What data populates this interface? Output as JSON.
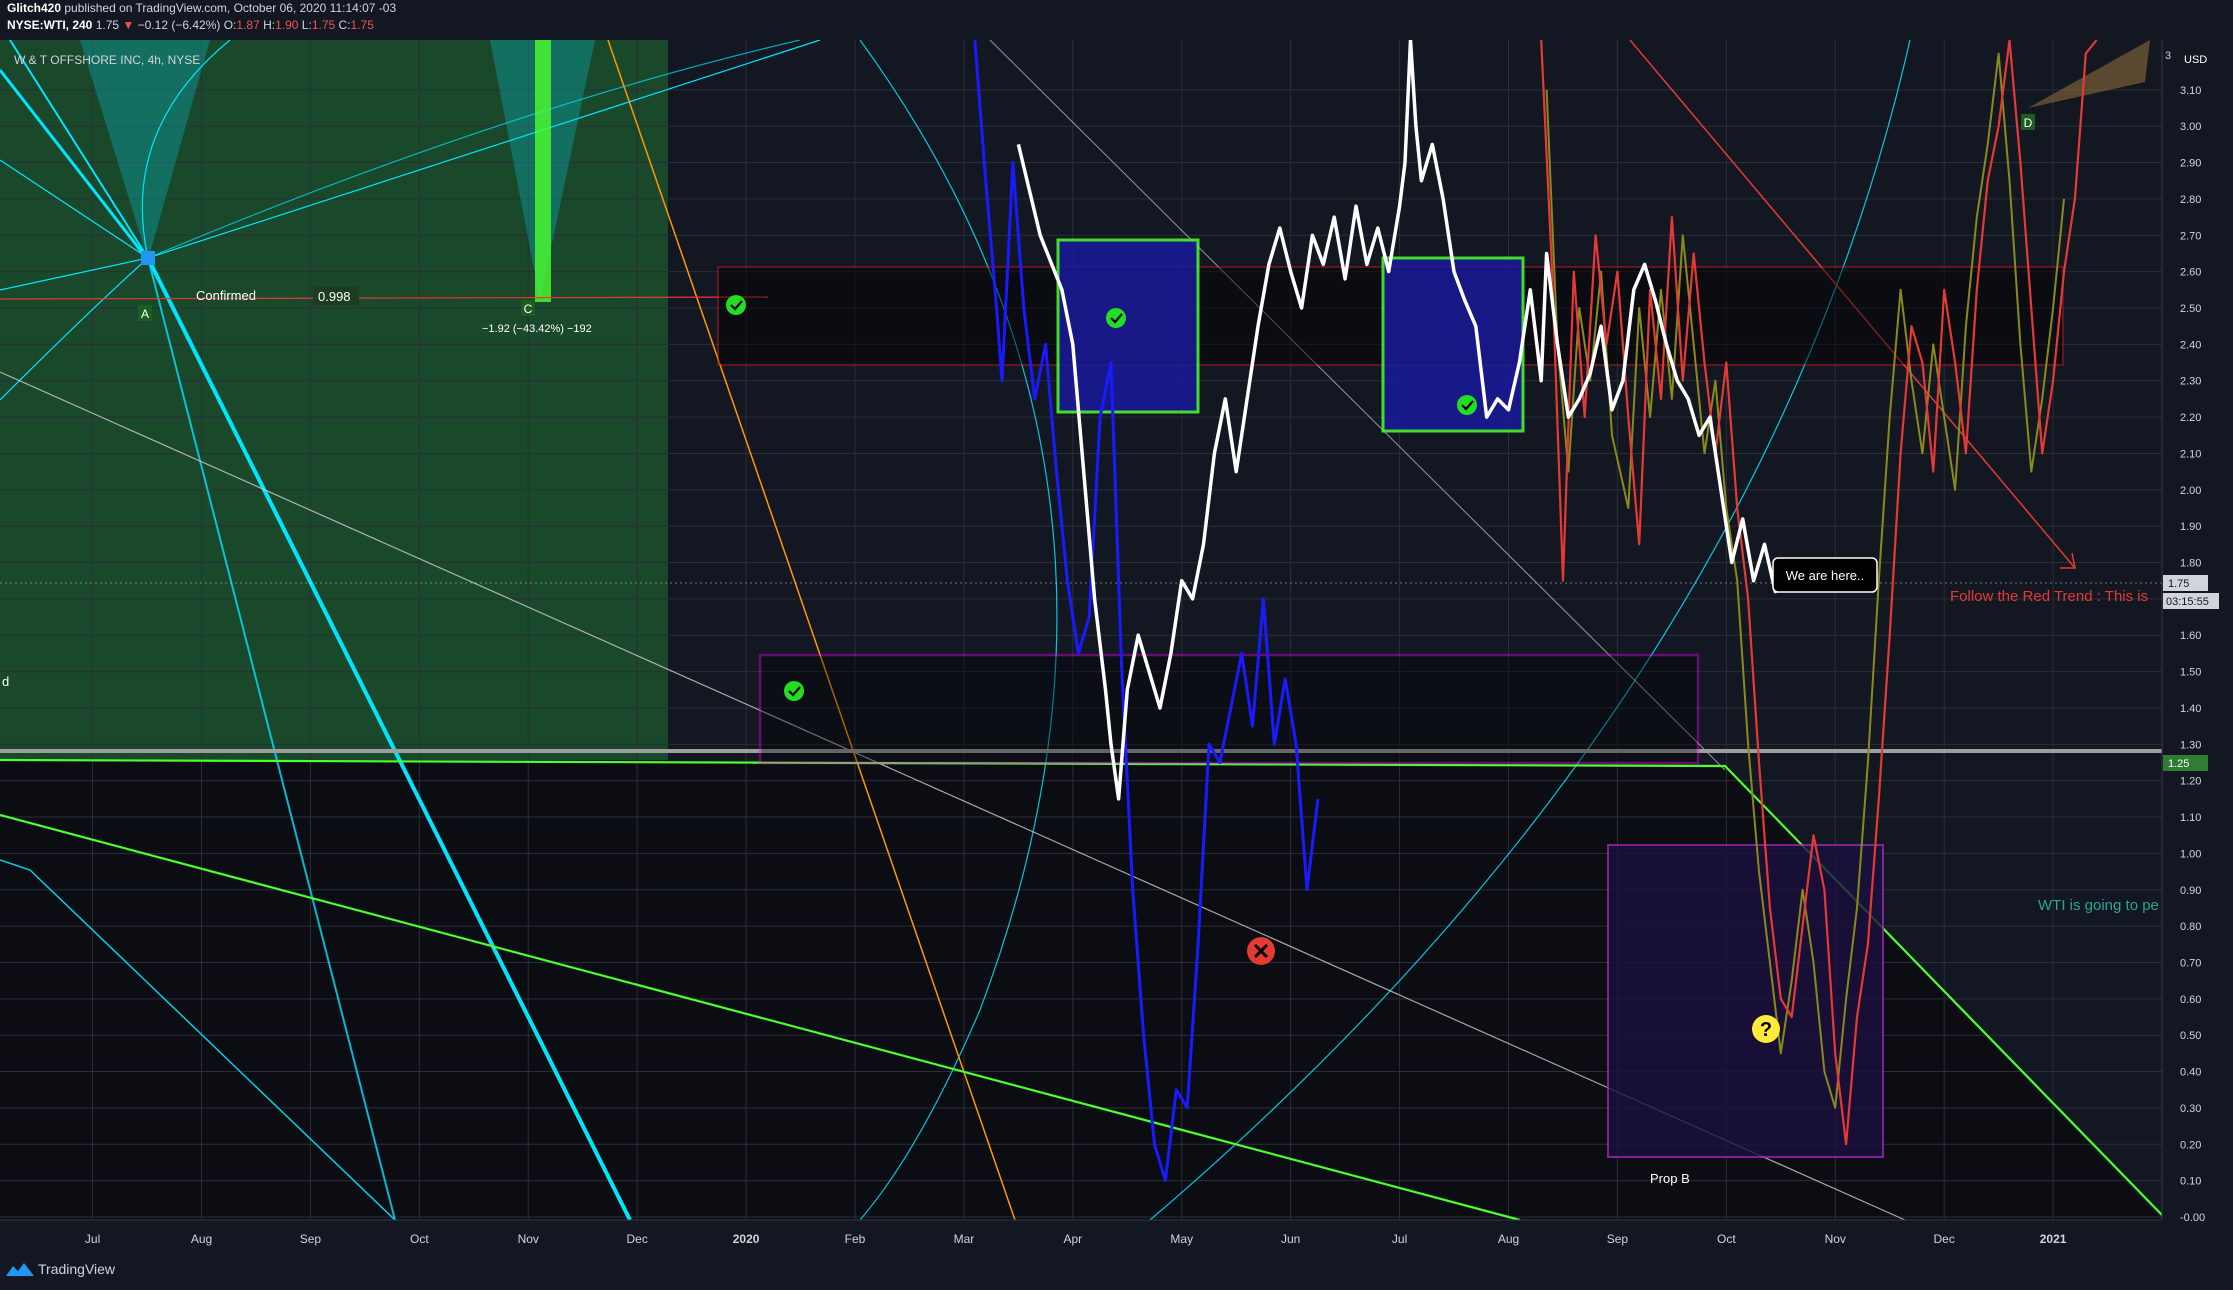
{
  "header": {
    "author": "Glitch420",
    "published": "published on TradingView.com, October 06, 2020 11:14:07 -03",
    "symbol": "NYSE:WTI, 240",
    "last": "1.75",
    "change_arrow": "▼",
    "change": "−0.12 (−6.42%)",
    "ohlc_o_label": "O:",
    "ohlc_o": "1.87",
    "ohlc_h_label": "H:",
    "ohlc_h": "1.90",
    "ohlc_l_label": "L:",
    "ohlc_l": "1.75",
    "ohlc_c_label": "C:",
    "ohlc_c": "1.75"
  },
  "legend": "W & T OFFSHORE INC, 4h, NYSE",
  "currency": "USD",
  "footer": {
    "brand": "TradingView"
  },
  "colors": {
    "background": "#131722",
    "price": "#ffffff",
    "blue_series": "#1a1aff",
    "red_series": "#e53935",
    "olive_series": "#8a8a1a",
    "cyan_lines": "#00e5ff",
    "green_lines": "#4cff2f",
    "magenta_box": "#ff00ff",
    "red_box": "#ff1a1a",
    "orange_line": "#ff9800"
  },
  "chart_data": {
    "type": "line",
    "title": "W & T OFFSHORE INC, 4h, NYSE",
    "ylabel": "USD",
    "ylim": [
      0.0,
      3.3
    ],
    "y_ticks": [
      "3.10",
      "3.00",
      "2.90",
      "2.80",
      "2.70",
      "2.60",
      "2.50",
      "2.40",
      "2.30",
      "2.20",
      "2.10",
      "2.00",
      "1.90",
      "1.80",
      "1.70",
      "1.60",
      "1.50",
      "1.40",
      "1.30",
      "1.20",
      "1.10",
      "1.00",
      "0.90",
      "0.80",
      "0.70",
      "0.60",
      "0.50",
      "0.40",
      "0.30",
      "0.20",
      "0.10",
      "-0.00"
    ],
    "x_ticks": [
      "Jul",
      "Aug",
      "Sep",
      "Oct",
      "Nov",
      "Dec",
      "2020",
      "Feb",
      "Mar",
      "Apr",
      "May",
      "Jun",
      "Jul",
      "Aug",
      "Sep",
      "Oct",
      "Nov",
      "Dec",
      "2021"
    ],
    "x_tick_months": [
      0,
      1,
      2,
      3,
      4,
      5,
      6,
      7,
      8,
      9,
      10,
      11,
      12,
      13,
      14,
      15,
      16,
      17,
      18
    ],
    "xlim_months": [
      -0.85,
      19.0
    ],
    "series": [
      {
        "name": "WTI",
        "points": [
          [
            8.5,
            2.95
          ],
          [
            8.7,
            2.7
          ],
          [
            8.9,
            2.55
          ],
          [
            9.0,
            2.4
          ],
          [
            9.1,
            2.05
          ],
          [
            9.2,
            1.7
          ],
          [
            9.3,
            1.45
          ],
          [
            9.35,
            1.3
          ],
          [
            9.42,
            1.15
          ],
          [
            9.5,
            1.45
          ],
          [
            9.6,
            1.6
          ],
          [
            9.7,
            1.5
          ],
          [
            9.8,
            1.4
          ],
          [
            9.9,
            1.55
          ],
          [
            10.0,
            1.75
          ],
          [
            10.1,
            1.7
          ],
          [
            10.2,
            1.85
          ],
          [
            10.3,
            2.1
          ],
          [
            10.4,
            2.25
          ],
          [
            10.5,
            2.05
          ],
          [
            10.6,
            2.25
          ],
          [
            10.7,
            2.45
          ],
          [
            10.8,
            2.62
          ],
          [
            10.9,
            2.72
          ],
          [
            11.0,
            2.6
          ],
          [
            11.1,
            2.5
          ],
          [
            11.2,
            2.7
          ],
          [
            11.3,
            2.62
          ],
          [
            11.4,
            2.75
          ],
          [
            11.5,
            2.58
          ],
          [
            11.6,
            2.78
          ],
          [
            11.7,
            2.62
          ],
          [
            11.8,
            2.72
          ],
          [
            11.9,
            2.6
          ],
          [
            12.0,
            2.78
          ],
          [
            12.05,
            2.9
          ],
          [
            12.1,
            3.3
          ],
          [
            12.15,
            3.0
          ],
          [
            12.2,
            2.85
          ],
          [
            12.3,
            2.95
          ],
          [
            12.4,
            2.8
          ],
          [
            12.5,
            2.6
          ],
          [
            12.6,
            2.52
          ],
          [
            12.7,
            2.45
          ],
          [
            12.8,
            2.2
          ],
          [
            12.9,
            2.25
          ],
          [
            13.0,
            2.22
          ],
          [
            13.1,
            2.35
          ],
          [
            13.2,
            2.55
          ],
          [
            13.3,
            2.3
          ],
          [
            13.35,
            2.65
          ],
          [
            13.45,
            2.4
          ],
          [
            13.55,
            2.2
          ],
          [
            13.65,
            2.25
          ],
          [
            13.75,
            2.32
          ],
          [
            13.85,
            2.45
          ],
          [
            13.95,
            2.22
          ],
          [
            14.05,
            2.3
          ],
          [
            14.15,
            2.55
          ],
          [
            14.25,
            2.62
          ],
          [
            14.35,
            2.52
          ],
          [
            14.45,
            2.4
          ],
          [
            14.55,
            2.3
          ],
          [
            14.65,
            2.25
          ],
          [
            14.75,
            2.15
          ],
          [
            14.85,
            2.2
          ],
          [
            14.95,
            2.0
          ],
          [
            15.05,
            1.8
          ],
          [
            15.15,
            1.92
          ],
          [
            15.25,
            1.75
          ],
          [
            15.35,
            1.85
          ],
          [
            15.45,
            1.72
          ],
          [
            15.55,
            1.8
          ],
          [
            15.65,
            1.75
          ]
        ]
      },
      {
        "name": "Blue fractal",
        "points": [
          [
            8.1,
            3.3
          ],
          [
            8.2,
            2.85
          ],
          [
            8.3,
            2.5
          ],
          [
            8.35,
            2.3
          ],
          [
            8.45,
            2.9
          ],
          [
            8.55,
            2.5
          ],
          [
            8.65,
            2.25
          ],
          [
            8.75,
            2.4
          ],
          [
            8.85,
            2.05
          ],
          [
            8.95,
            1.75
          ],
          [
            9.05,
            1.55
          ],
          [
            9.15,
            1.65
          ],
          [
            9.25,
            2.2
          ],
          [
            9.35,
            2.35
          ],
          [
            9.45,
            1.5
          ],
          [
            9.55,
            0.9
          ],
          [
            9.65,
            0.5
          ],
          [
            9.75,
            0.2
          ],
          [
            9.85,
            0.1
          ],
          [
            9.95,
            0.35
          ],
          [
            10.05,
            0.3
          ],
          [
            10.15,
            0.75
          ],
          [
            10.25,
            1.3
          ],
          [
            10.35,
            1.25
          ],
          [
            10.45,
            1.4
          ],
          [
            10.55,
            1.55
          ],
          [
            10.65,
            1.35
          ],
          [
            10.75,
            1.7
          ],
          [
            10.85,
            1.3
          ],
          [
            10.95,
            1.48
          ],
          [
            11.05,
            1.3
          ],
          [
            11.15,
            0.9
          ],
          [
            11.25,
            1.15
          ]
        ]
      },
      {
        "name": "Red projection",
        "points": [
          [
            13.3,
            3.3
          ],
          [
            13.4,
            2.6
          ],
          [
            13.5,
            1.75
          ],
          [
            13.6,
            2.6
          ],
          [
            13.7,
            2.2
          ],
          [
            13.8,
            2.7
          ],
          [
            13.9,
            2.4
          ],
          [
            14.0,
            2.6
          ],
          [
            14.1,
            2.2
          ],
          [
            14.2,
            1.85
          ],
          [
            14.3,
            2.55
          ],
          [
            14.4,
            2.25
          ],
          [
            14.5,
            2.75
          ],
          [
            14.6,
            2.3
          ],
          [
            14.7,
            2.65
          ],
          [
            14.8,
            2.35
          ],
          [
            14.9,
            2.1
          ],
          [
            15.0,
            2.35
          ],
          [
            15.1,
            1.95
          ],
          [
            15.2,
            1.7
          ],
          [
            15.3,
            1.25
          ],
          [
            15.4,
            0.85
          ],
          [
            15.5,
            0.6
          ],
          [
            15.6,
            0.55
          ],
          [
            15.7,
            0.8
          ],
          [
            15.8,
            1.05
          ],
          [
            15.9,
            0.9
          ],
          [
            16.0,
            0.45
          ],
          [
            16.1,
            0.2
          ],
          [
            16.2,
            0.55
          ],
          [
            16.3,
            0.75
          ],
          [
            16.4,
            1.15
          ],
          [
            16.5,
            1.6
          ],
          [
            16.6,
            2.1
          ],
          [
            16.7,
            2.45
          ],
          [
            16.8,
            2.35
          ],
          [
            16.9,
            2.05
          ],
          [
            17.0,
            2.55
          ],
          [
            17.1,
            2.35
          ],
          [
            17.2,
            2.1
          ],
          [
            17.3,
            2.55
          ],
          [
            17.4,
            2.85
          ],
          [
            17.5,
            3.0
          ],
          [
            17.6,
            3.3
          ],
          [
            17.7,
            2.9
          ],
          [
            17.8,
            2.5
          ],
          [
            17.9,
            2.1
          ],
          [
            18.0,
            2.3
          ],
          [
            18.1,
            2.6
          ],
          [
            18.2,
            2.8
          ],
          [
            18.3,
            3.2
          ],
          [
            18.4,
            3.3
          ]
        ]
      },
      {
        "name": "Olive projection",
        "points": [
          [
            13.35,
            3.1
          ],
          [
            13.45,
            2.4
          ],
          [
            13.55,
            2.05
          ],
          [
            13.65,
            2.5
          ],
          [
            13.75,
            2.3
          ],
          [
            13.85,
            2.6
          ],
          [
            13.95,
            2.15
          ],
          [
            14.1,
            1.95
          ],
          [
            14.2,
            2.5
          ],
          [
            14.3,
            2.2
          ],
          [
            14.4,
            2.55
          ],
          [
            14.5,
            2.25
          ],
          [
            14.6,
            2.7
          ],
          [
            14.7,
            2.4
          ],
          [
            14.8,
            2.1
          ],
          [
            14.9,
            2.3
          ],
          [
            15.0,
            1.95
          ],
          [
            15.1,
            1.75
          ],
          [
            15.2,
            1.3
          ],
          [
            15.3,
            0.95
          ],
          [
            15.4,
            0.7
          ],
          [
            15.5,
            0.45
          ],
          [
            15.6,
            0.65
          ],
          [
            15.7,
            0.9
          ],
          [
            15.8,
            0.7
          ],
          [
            15.9,
            0.4
          ],
          [
            16.0,
            0.3
          ],
          [
            16.1,
            0.6
          ],
          [
            16.2,
            0.85
          ],
          [
            16.3,
            1.25
          ],
          [
            16.4,
            1.75
          ],
          [
            16.5,
            2.2
          ],
          [
            16.6,
            2.55
          ],
          [
            16.7,
            2.3
          ],
          [
            16.8,
            2.1
          ],
          [
            16.9,
            2.4
          ],
          [
            17.0,
            2.2
          ],
          [
            17.1,
            2.0
          ],
          [
            17.2,
            2.45
          ],
          [
            17.3,
            2.75
          ],
          [
            17.4,
            2.95
          ],
          [
            17.5,
            3.2
          ],
          [
            17.6,
            2.85
          ],
          [
            17.7,
            2.4
          ],
          [
            17.8,
            2.05
          ],
          [
            17.9,
            2.25
          ],
          [
            18.0,
            2.5
          ],
          [
            18.1,
            2.8
          ]
        ]
      }
    ],
    "annotations": [
      {
        "text": "Confirmed",
        "kind": "label"
      },
      {
        "text": "0.998",
        "kind": "label"
      },
      {
        "text": "A",
        "kind": "pivot"
      },
      {
        "text": "C",
        "kind": "pivot"
      },
      {
        "text": "D",
        "kind": "pivot"
      },
      {
        "text": "−1.92 (−43.42%) −192",
        "kind": "measure"
      },
      {
        "text": "We are here..",
        "kind": "callout"
      },
      {
        "text": "Follow the Red Trend : This is",
        "kind": "note"
      },
      {
        "text": "WTI is going to pe",
        "kind": "note"
      },
      {
        "text": "Prop B",
        "kind": "label"
      },
      {
        "text": "d",
        "kind": "label"
      }
    ],
    "price_tags": [
      {
        "text": "3",
        "price": 3.3
      },
      {
        "text": "1.75",
        "price": 1.75
      },
      {
        "text": "03:15:55",
        "price": 1.7
      },
      {
        "text": "1.25",
        "price": 1.25
      }
    ],
    "zones": [
      {
        "name": "red resistance zone",
        "ylim": [
          2.34,
          2.62
        ]
      },
      {
        "name": "magenta support zone",
        "ylim": [
          1.26,
          1.55
        ]
      },
      {
        "name": "Prop B box",
        "ylim": [
          0.16,
          1.03
        ]
      }
    ]
  }
}
